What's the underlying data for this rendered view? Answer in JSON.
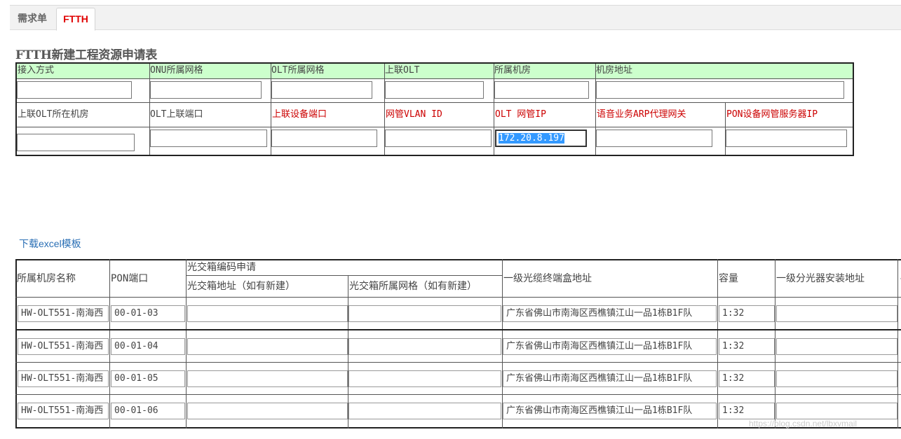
{
  "tabs": [
    {
      "label": "需求单",
      "active": false
    },
    {
      "label": "FTTH",
      "active": true
    }
  ],
  "title": "FTTH新建工程资源申请表",
  "form": {
    "row1_headers": [
      "接入方式",
      "ONU所属网格",
      "OLT所属网格",
      "上联OLT",
      "所属机房",
      "机房地址"
    ],
    "row1_values": [
      "",
      "",
      "",
      "",
      "",
      ""
    ],
    "row2_labels": [
      "上联OLT所在机房",
      "OLT上联端口",
      "上联设备端口",
      "网管VLAN ID",
      "OLT 网管IP",
      "语音业务ARP代理网关",
      "PON设备网管服务器IP"
    ],
    "row2_values": [
      "",
      "",
      "",
      "",
      "172.20.8.197",
      "",
      ""
    ]
  },
  "download_link": "下载excel模板",
  "table": {
    "headers": {
      "room_name": "所属机房名称",
      "pon_port": "PON端口",
      "group": "光交箱编码申请",
      "box_addr": "光交箱地址（如有新建）",
      "box_grid": "光交箱所属网格（如有新建）",
      "term_addr": "一级光缆终端盒地址",
      "capacity": "容量",
      "splitter_addr": "一级分光器安装地址"
    },
    "rows": [
      {
        "room": "HW-OLT551-南海西",
        "port": "00-01-03",
        "box_addr": "",
        "box_grid": "",
        "term": "广东省佛山市南海区西樵镇江山一品1栋B1F队",
        "cap": "1:32",
        "split": ""
      },
      {
        "room": "HW-OLT551-南海西",
        "port": "00-01-04",
        "box_addr": "",
        "box_grid": "",
        "term": "广东省佛山市南海区西樵镇江山一品1栋B1F队",
        "cap": "1:32",
        "split": ""
      },
      {
        "room": "HW-OLT551-南海西",
        "port": "00-01-05",
        "box_addr": "",
        "box_grid": "",
        "term": "广东省佛山市南海区西樵镇江山一品1栋B1F队",
        "cap": "1:32",
        "split": ""
      },
      {
        "room": "HW-OLT551-南海西",
        "port": "00-01-06",
        "box_addr": "",
        "box_grid": "",
        "term": "广东省佛山市南海区西樵镇江山一品1栋B1F队",
        "cap": "1:32",
        "split": ""
      }
    ]
  },
  "watermark": "https://blog.csdn.net/lbxvmail"
}
